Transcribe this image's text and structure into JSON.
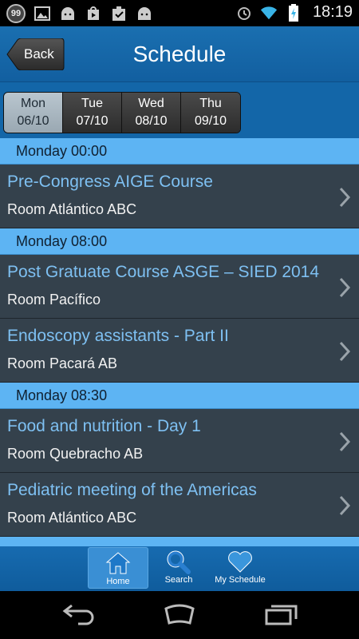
{
  "status_bar": {
    "notification_count": "99",
    "time": "18:19",
    "icons": [
      "notification-badge",
      "image-icon",
      "android-icon",
      "play-store-icon",
      "checklist-icon",
      "android-icon",
      "alarm-icon",
      "wifi-icon",
      "battery-charging-icon"
    ]
  },
  "header": {
    "back_label": "Back",
    "title": "Schedule"
  },
  "day_tabs": [
    {
      "day": "Mon",
      "date": "06/10",
      "selected": true
    },
    {
      "day": "Tue",
      "date": "07/10",
      "selected": false
    },
    {
      "day": "Wed",
      "date": "08/10",
      "selected": false
    },
    {
      "day": "Thu",
      "date": "09/10",
      "selected": false
    }
  ],
  "schedule": [
    {
      "time": "Monday 00:00",
      "events": [
        {
          "title": "Pre-Congress AIGE Course",
          "room": "Room Atlántico ABC"
        }
      ]
    },
    {
      "time": "Monday 08:00",
      "events": [
        {
          "title": "Post Gratuate Course ASGE – SIED 2014",
          "room": "Room Pacífico"
        },
        {
          "title": "Endoscopy assistants - Part II",
          "room": "Room Pacará AB"
        }
      ]
    },
    {
      "time": "Monday 08:30",
      "events": [
        {
          "title": "Food and nutrition - Day 1",
          "room": "Room Quebracho AB"
        },
        {
          "title": "Pediatric meeting of the Americas",
          "room": "Room Atlántico ABC"
        }
      ]
    }
  ],
  "bottom_tabs": {
    "home": "Home",
    "search": "Search",
    "my_schedule": "My Schedule"
  },
  "colors": {
    "header_blue": "#1366a8",
    "section_blue": "#5db4f3",
    "title_blue": "#7ec0f2",
    "row_dark": "#34414c"
  }
}
